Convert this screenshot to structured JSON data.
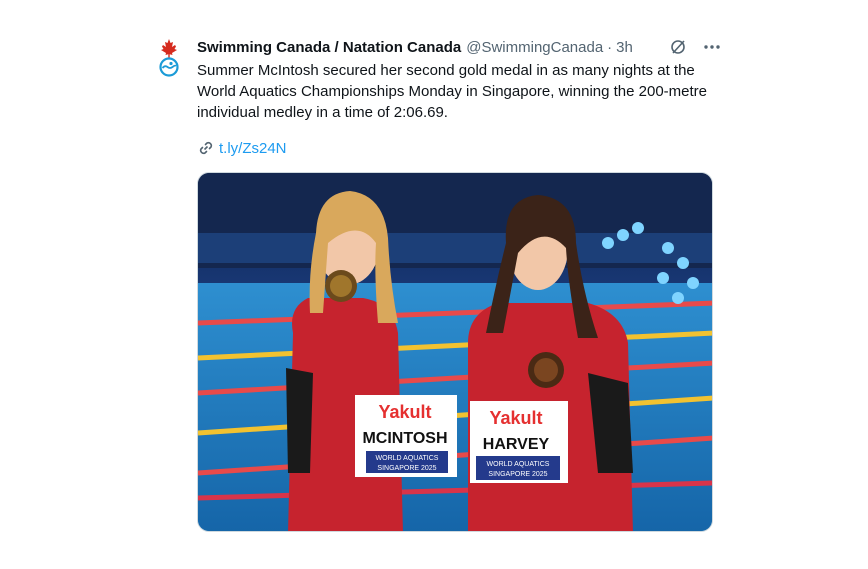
{
  "account": {
    "name": "Swimming Canada / Natation Canada",
    "handle": "@SwimmingCanada",
    "separator": "·",
    "time": "3h"
  },
  "tweet": {
    "text": "Summer McIntosh secured her second gold medal in as many nights at the World Aquatics Championships Monday in Singapore, winning the 200-metre individual medley in a time of 2:06.69.",
    "link": "t.ly/Zs24N"
  },
  "media": {
    "bib_left_sponsor": "Yakult",
    "bib_left_name": "MCINTOSH",
    "bib_left_org": "WORLD AQUATICS",
    "bib_left_city": "SINGAPORE 2025",
    "bib_right_sponsor": "Yakult",
    "bib_right_name": "HARVEY",
    "bib_right_org": "WORLD AQUATICS",
    "bib_right_city": "SINGAPORE 2025"
  },
  "colors": {
    "link": "#1d9bf0",
    "secondary_text": "#536471",
    "canada_red": "#d52b1e",
    "avatar_blue": "#1b9bd7"
  },
  "icons": [
    "maple-leaf-logo",
    "grok-icon",
    "more-icon",
    "link-icon"
  ]
}
